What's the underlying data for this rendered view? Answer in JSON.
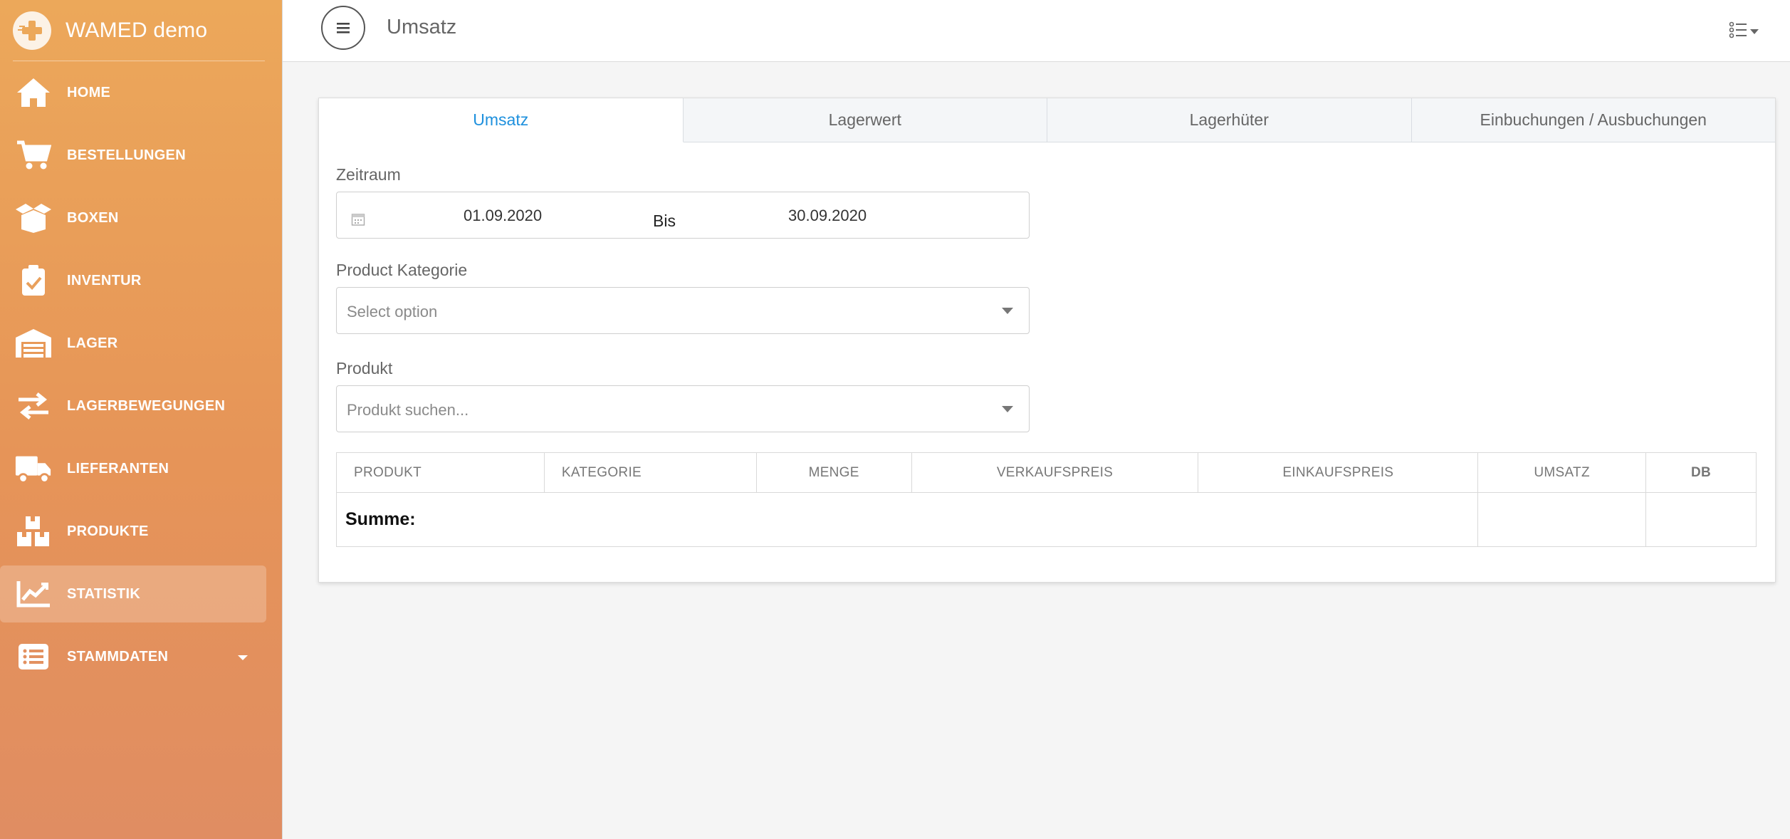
{
  "app": {
    "brand": "WAMED demo",
    "page_title": "Umsatz"
  },
  "sidebar": {
    "items": [
      {
        "label": "HOME",
        "icon": "home-icon"
      },
      {
        "label": "BESTELLUNGEN",
        "icon": "cart-icon"
      },
      {
        "label": "BOXEN",
        "icon": "box-icon"
      },
      {
        "label": "INVENTUR",
        "icon": "clipboard-check-icon"
      },
      {
        "label": "LAGER",
        "icon": "warehouse-icon"
      },
      {
        "label": "LAGERBEWEGUNGEN",
        "icon": "transfer-arrows-icon"
      },
      {
        "label": "LIEFERANTEN",
        "icon": "truck-icon"
      },
      {
        "label": "PRODUKTE",
        "icon": "boxes-icon"
      },
      {
        "label": "STATISTIK",
        "icon": "chart-line-icon",
        "active": true
      },
      {
        "label": "STAMMDATEN",
        "icon": "list-icon",
        "has_submenu": true
      }
    ]
  },
  "tabs": [
    {
      "label": "Umsatz",
      "active": true
    },
    {
      "label": "Lagerwert"
    },
    {
      "label": "Lagerhüter"
    },
    {
      "label": "Einbuchungen / Ausbuchungen"
    }
  ],
  "filters": {
    "zeitraum_label": "Zeitraum",
    "date_from": "01.09.2020",
    "date_separator": "Bis",
    "date_to": "30.09.2020",
    "kategorie_label": "Product Kategorie",
    "kategorie_placeholder": "Select option",
    "produkt_label": "Produkt",
    "produkt_placeholder": "Produkt suchen..."
  },
  "table": {
    "columns": [
      "PRODUKT",
      "KATEGORIE",
      "MENGE",
      "VERKAUFSPREIS",
      "EINKAUFSPREIS",
      "UMSATZ",
      "DB"
    ],
    "sum_label": "Summe:",
    "sum_umsatz": "",
    "sum_db": ""
  },
  "colors": {
    "sidebar_top": "#eca85a",
    "sidebar_bottom": "#e08d62",
    "accent": "#1e90dd"
  }
}
